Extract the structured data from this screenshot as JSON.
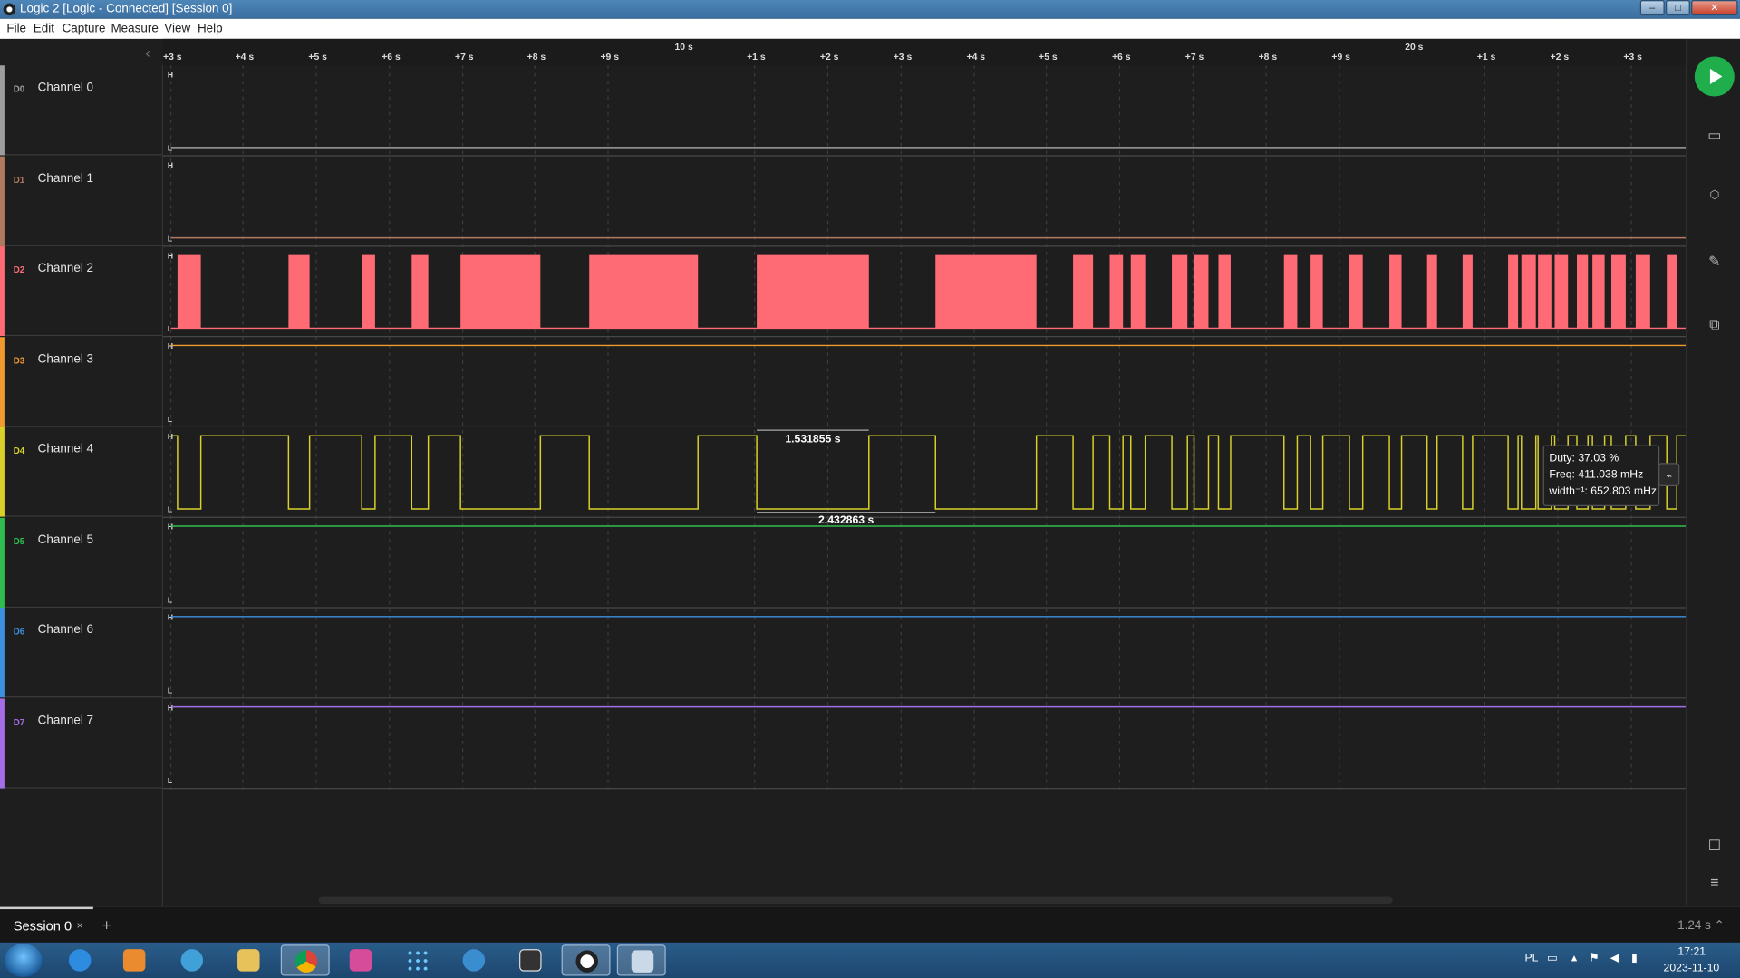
{
  "window": {
    "title": "Logic 2 [Logic - Connected] [Session 0]",
    "buttons": [
      "–",
      "□",
      "✕"
    ]
  },
  "menu": [
    "File",
    "Edit",
    "Capture",
    "Measure",
    "View",
    "Help"
  ],
  "ruler": {
    "ticks": [
      "+3 s",
      "+4 s",
      "+5 s",
      "+6 s",
      "+7 s",
      "+8 s",
      "+9 s",
      "+1 s",
      "+2 s",
      "+3 s",
      "+4 s",
      "+5 s",
      "+6 s",
      "+7 s",
      "+8 s",
      "+9 s",
      "+1 s",
      "+2 s",
      "+3 s"
    ],
    "majors": [
      "10 s",
      "20 s"
    ]
  },
  "channels": [
    {
      "id": "D0",
      "name": "Channel 0",
      "color": "#9e9e9e",
      "state": "low"
    },
    {
      "id": "D1",
      "name": "Channel 1",
      "color": "#b07a60",
      "state": "low"
    },
    {
      "id": "D2",
      "name": "Channel 2",
      "color": "#ff6b75",
      "state": "pulses"
    },
    {
      "id": "D3",
      "name": "Channel 3",
      "color": "#f29a2e",
      "state": "high"
    },
    {
      "id": "D4",
      "name": "Channel 4",
      "color": "#d9d12a",
      "state": "pulses"
    },
    {
      "id": "D5",
      "name": "Channel 5",
      "color": "#2ebd4e",
      "state": "high"
    },
    {
      "id": "D6",
      "name": "Channel 6",
      "color": "#3d8fe0",
      "state": "high"
    },
    {
      "id": "D7",
      "name": "Channel 7",
      "color": "#a56ee6",
      "state": "high"
    }
  ],
  "level_labels": {
    "high": "H",
    "low": "L"
  },
  "measurements": {
    "pulse_width": "1.531855 s",
    "period": "2.432863 s",
    "tooltip": {
      "duty": "Duty: 37.03 %",
      "freq": "Freq: 411.038 mHz",
      "width": "width⁻¹: 652.803 mHz"
    }
  },
  "right_toolbar": [
    "play-icon",
    "timing-icon",
    "analyzer-icon",
    "measure-icon",
    "extensions-icon",
    "notes-icon",
    "menu-icon"
  ],
  "session": {
    "tab_label": "Session 0",
    "close": "×",
    "add": "+",
    "zoom": "1.24 s ⌃"
  },
  "taskbar": {
    "apps": [
      "ie-icon",
      "media-icon",
      "browser-icon",
      "explorer-icon",
      "chrome-icon",
      "paint-icon",
      "dots-icon",
      "mu-icon",
      "clapper-icon",
      "logic-icon",
      "paint2-icon"
    ],
    "lang": "PL",
    "time": "17:21",
    "date": "2023-11-10"
  }
}
